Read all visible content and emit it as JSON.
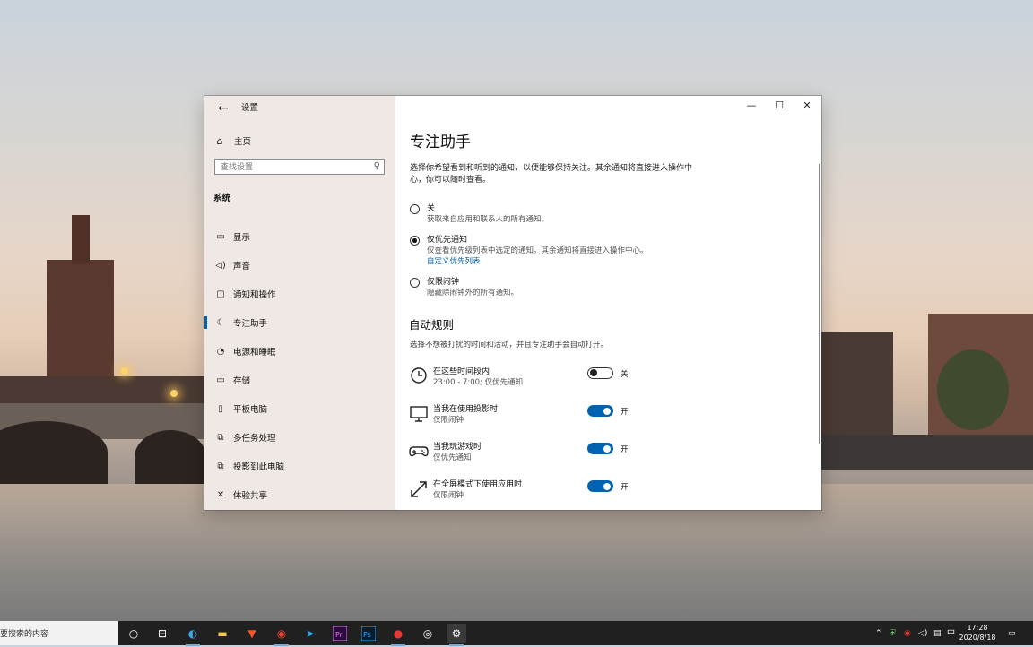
{
  "window": {
    "title": "设置",
    "back_glyph": "←",
    "minimize_glyph": "—",
    "maximize_glyph": "☐",
    "close_glyph": "✕"
  },
  "sidebar": {
    "home_label": "主页",
    "search_placeholder": "查找设置",
    "group_label": "系统",
    "items": [
      {
        "label": "显示",
        "icon": "monitor-icon",
        "glyph": "▭"
      },
      {
        "label": "声音",
        "icon": "speaker-icon",
        "glyph": "🔈"
      },
      {
        "label": "通知和操作",
        "icon": "notification-icon",
        "glyph": "▢"
      },
      {
        "label": "专注助手",
        "icon": "moon-icon",
        "glyph": "☾",
        "active": true
      },
      {
        "label": "电源和睡眠",
        "icon": "power-icon",
        "glyph": "⏻"
      },
      {
        "label": "存储",
        "icon": "storage-icon",
        "glyph": "▭"
      },
      {
        "label": "平板电脑",
        "icon": "tablet-icon",
        "glyph": "▯"
      },
      {
        "label": "多任务处理",
        "icon": "multitask-icon",
        "glyph": "⧉"
      },
      {
        "label": "投影到此电脑",
        "icon": "project-icon",
        "glyph": "⧉"
      },
      {
        "label": "体验共享",
        "icon": "share-icon",
        "glyph": "✕"
      }
    ]
  },
  "main": {
    "title": "专注助手",
    "description": "选择你希望看到和听到的通知，以便能够保持关注。其余通知将直接进入操作中心，你可以随时查看。",
    "options": [
      {
        "label": "关",
        "sub": "获取来自应用和联系人的所有通知。",
        "selected": false
      },
      {
        "label": "仅优先通知",
        "sub": "仅查看优先级列表中选定的通知。其余通知将直接进入操作中心。",
        "link": "自定义优先列表",
        "selected": true
      },
      {
        "label": "仅限闹钟",
        "sub": "隐藏除闹钟外的所有通知。",
        "selected": false
      }
    ],
    "rules_title": "自动规则",
    "rules_desc": "选择不想被打扰的时间和活动，并且专注助手会自动打开。",
    "rules": [
      {
        "title": "在这些时间段内",
        "sub": "23:00 - 7:00; 仅优先通知",
        "icon": "clock-icon",
        "on": false,
        "state": "关"
      },
      {
        "title": "当我在使用投影时",
        "sub": "仅限闹钟",
        "icon": "display-icon",
        "on": true,
        "state": "开"
      },
      {
        "title": "当我玩游戏时",
        "sub": "仅优先通知",
        "icon": "gamepad-icon",
        "on": true,
        "state": "开"
      },
      {
        "title": "在全屏模式下使用应用时",
        "sub": "仅限闹钟",
        "icon": "fullscreen-arrow-icon",
        "on": true,
        "state": "开"
      }
    ]
  },
  "taskbar": {
    "search_text": "要搜索的内容",
    "ime": "中",
    "time": "17:28",
    "date": "2020/8/18"
  }
}
